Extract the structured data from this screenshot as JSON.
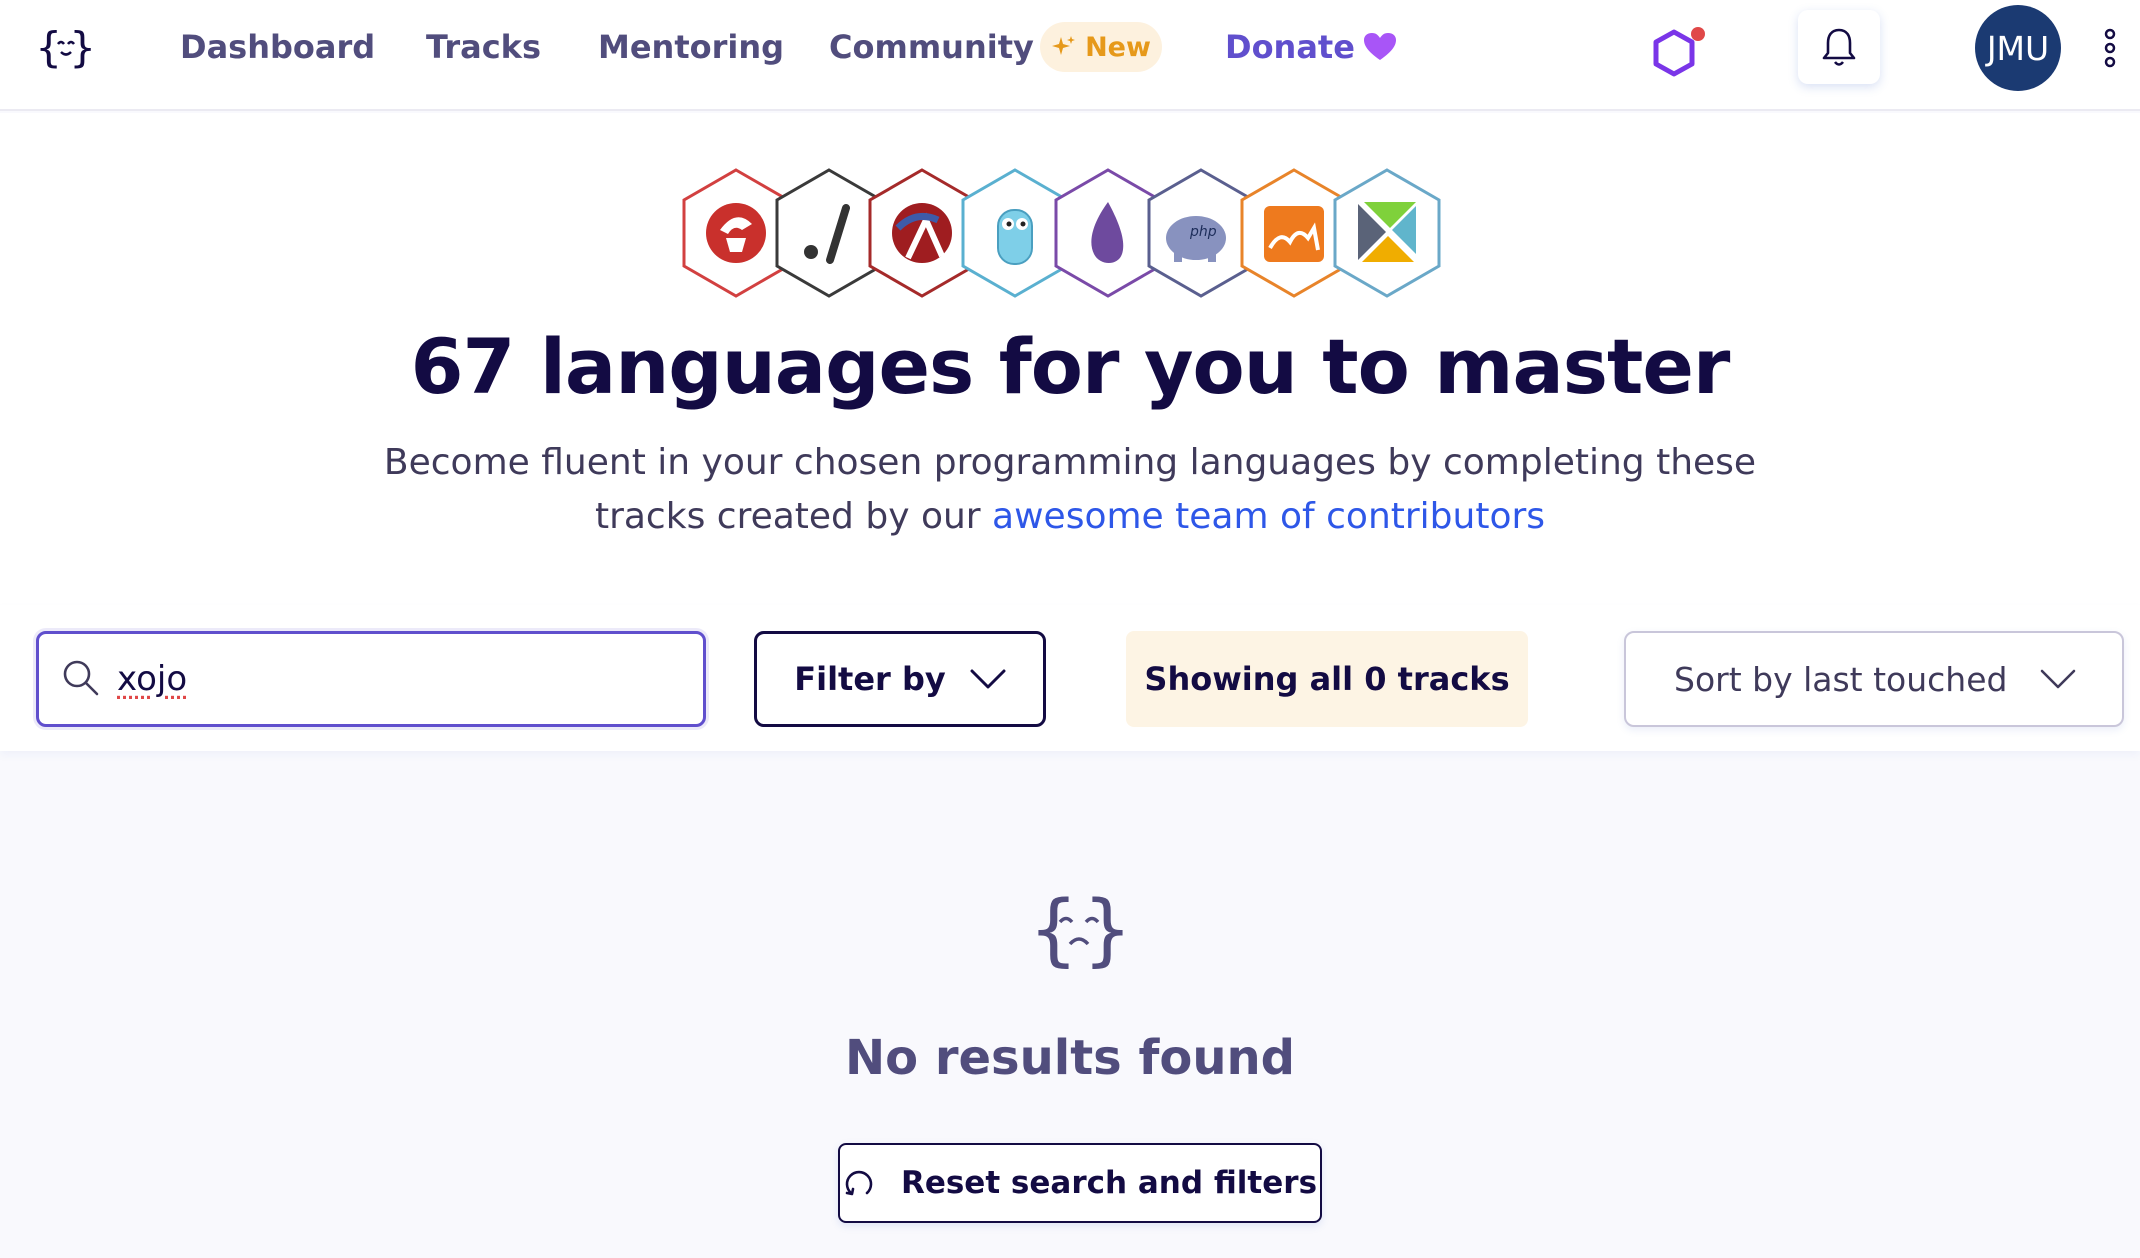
{
  "nav": {
    "links": [
      "Dashboard",
      "Tracks",
      "Mentoring",
      "Community"
    ],
    "new_badge": "New",
    "donate": "Donate",
    "avatar_initials": "JMU"
  },
  "hero": {
    "track_icons": [
      "delphi-icon",
      "bash-icon",
      "racket-icon",
      "go-icon",
      "elixir-icon",
      "php-icon",
      "ocaml-icon",
      "elm-icon"
    ],
    "title": "67 languages for you to master",
    "subtitle_text": "Become fluent in your chosen programming languages by completing these tracks created by our",
    "subtitle_link": "awesome team of contributors"
  },
  "filters": {
    "search_value": "xojo",
    "filter_label": "Filter by",
    "status_text": "Showing all 0 tracks",
    "sort_label": "Sort by last touched"
  },
  "empty": {
    "title": "No results found",
    "reset_label": "Reset search and filters"
  },
  "colors": {
    "brand_dark": "#130b43",
    "nav_text": "#514d7d",
    "accent_purple": "#604fcd",
    "link_blue": "#2e57e8",
    "new_badge_bg": "#fdf1de",
    "new_badge_text": "#e6991a",
    "status_bg": "#fdf4e4",
    "avatar_bg": "#1b3a72"
  }
}
